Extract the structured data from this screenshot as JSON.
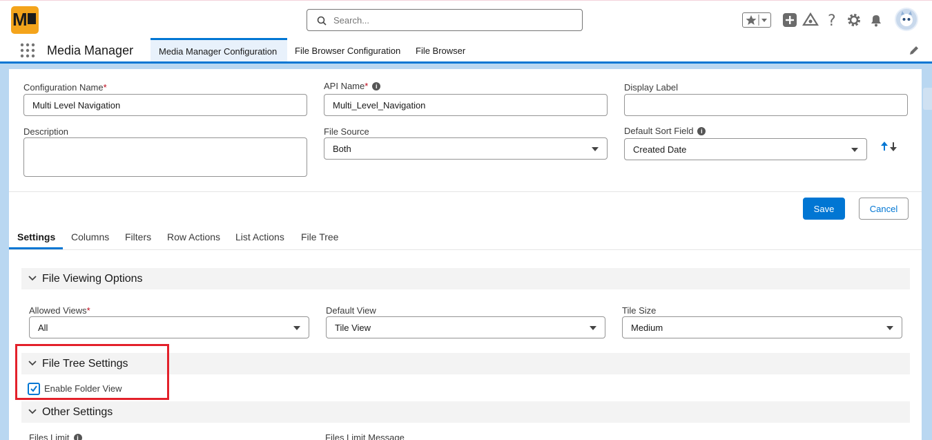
{
  "header": {
    "search_placeholder": "Search...",
    "app_name": "Media Manager",
    "nav_tabs": [
      "Media Manager Configuration",
      "File Browser Configuration",
      "File Browser"
    ]
  },
  "form": {
    "configuration_name": {
      "label": "Configuration Name",
      "required": "*",
      "value": "Multi Level Navigation"
    },
    "api_name": {
      "label": "API Name",
      "required": "*",
      "value": "Multi_Level_Navigation"
    },
    "display_label": {
      "label": "Display Label",
      "value": ""
    },
    "description": {
      "label": "Description",
      "value": ""
    },
    "file_source": {
      "label": "File Source",
      "value": "Both"
    },
    "default_sort_field": {
      "label": "Default Sort Field",
      "value": "Created Date"
    },
    "save_label": "Save",
    "cancel_label": "Cancel"
  },
  "tabs": [
    "Settings",
    "Columns",
    "Filters",
    "Row Actions",
    "List Actions",
    "File Tree"
  ],
  "sections": {
    "file_viewing": {
      "title": "File Viewing Options",
      "allowed_views": {
        "label": "Allowed Views",
        "required": "*",
        "value": "All"
      },
      "default_view": {
        "label": "Default View",
        "value": "Tile View"
      },
      "tile_size": {
        "label": "Tile Size",
        "value": "Medium"
      }
    },
    "file_tree": {
      "title": "File Tree Settings",
      "enable_folder_view": {
        "label": "Enable Folder View",
        "checked": true
      }
    },
    "other": {
      "title": "Other Settings",
      "files_limit_label": "Files Limit",
      "files_limit_message_label": "Files Limit Message"
    }
  },
  "colors": {
    "brand": "#0176d3",
    "highlight": "#e3202a",
    "logo": "#f4a41b"
  }
}
